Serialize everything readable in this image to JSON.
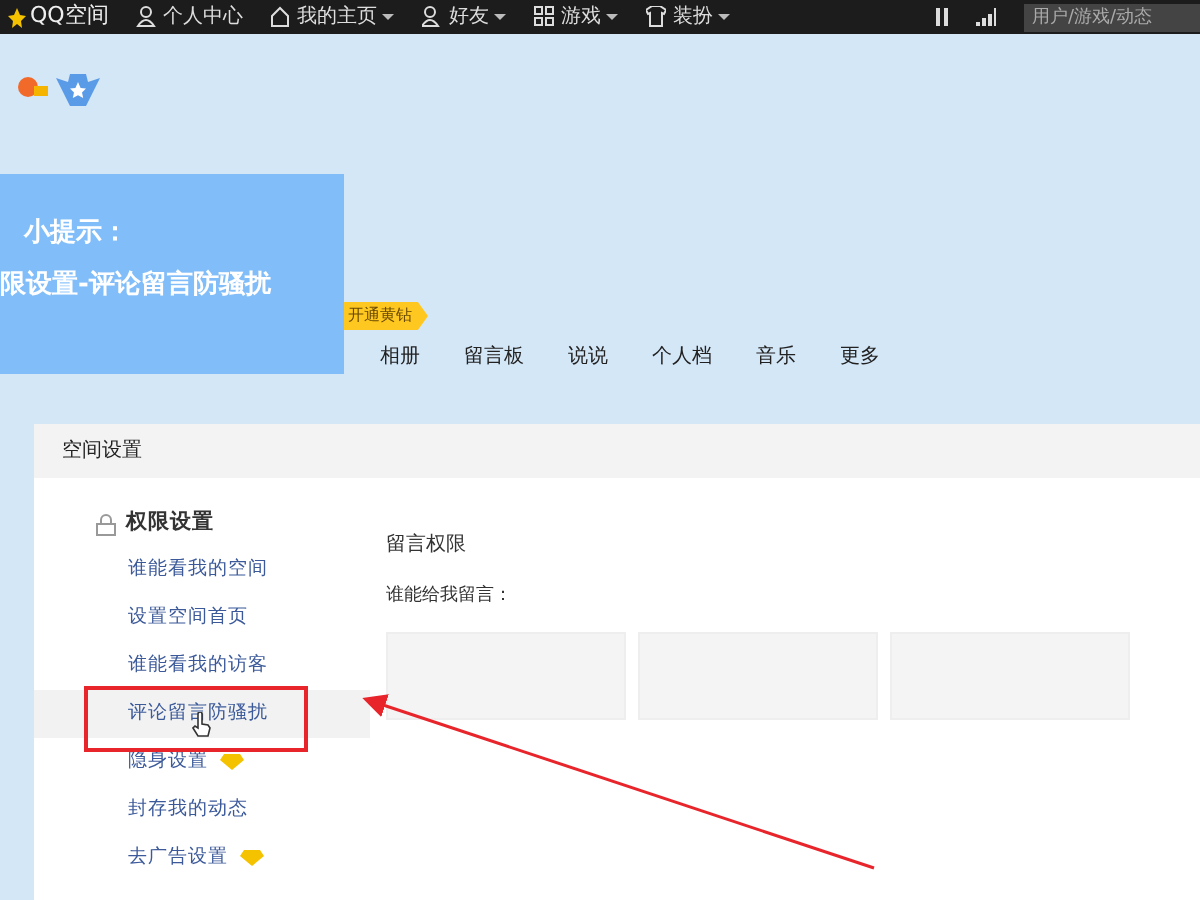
{
  "top_bar": {
    "logo": "QQ空间",
    "items": [
      {
        "label": "个人中心",
        "dropdown": false
      },
      {
        "label": "我的主页",
        "dropdown": true
      },
      {
        "label": "好友",
        "dropdown": true
      },
      {
        "label": "游戏",
        "dropdown": true
      },
      {
        "label": "装扮",
        "dropdown": true
      }
    ],
    "search": {
      "placeholder": "用户/游戏/动态"
    }
  },
  "tip": {
    "title": "小提示：",
    "text": "限设置-评论留言防骚扰"
  },
  "vip_badge": "开通黄钻",
  "nav_tabs": [
    "相册",
    "留言板",
    "说说",
    "个人档",
    "音乐",
    "更多"
  ],
  "panel": {
    "title": "空间设置",
    "sidebar": {
      "group": "权限设置",
      "items": [
        {
          "label": "谁能看我的空间",
          "selected": false,
          "diamond": false
        },
        {
          "label": "设置空间首页",
          "selected": false,
          "diamond": false
        },
        {
          "label": "谁能看我的访客",
          "selected": false,
          "diamond": false
        },
        {
          "label": "评论留言防骚扰",
          "selected": true,
          "diamond": false
        },
        {
          "label": "隐身设置",
          "selected": false,
          "diamond": true
        },
        {
          "label": "封存我的动态",
          "selected": false,
          "diamond": false
        },
        {
          "label": "去广告设置",
          "selected": false,
          "diamond": true
        }
      ]
    },
    "content": {
      "heading": "留言权限",
      "question": "谁能给我留言："
    }
  }
}
